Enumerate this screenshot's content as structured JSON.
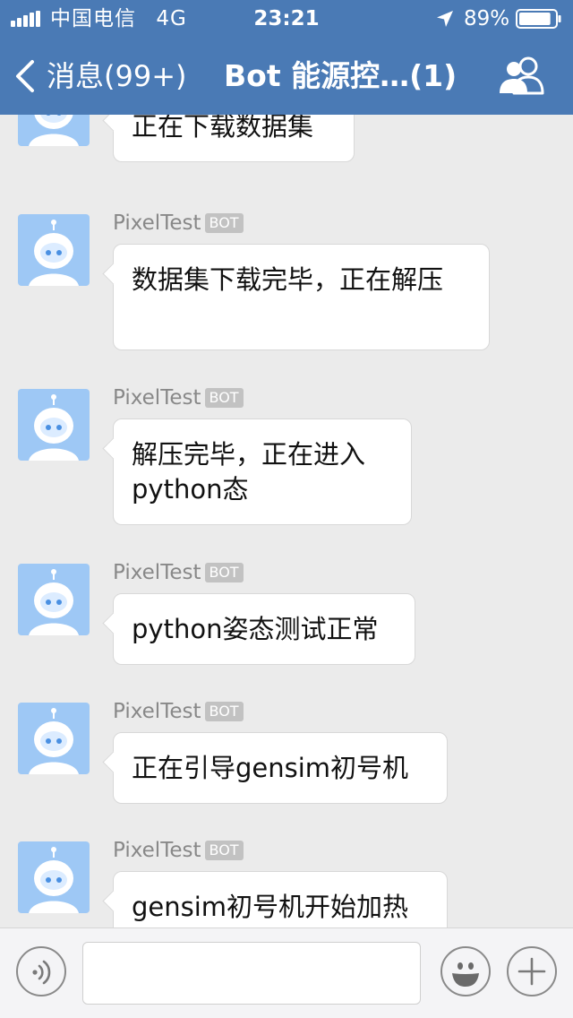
{
  "status_bar": {
    "carrier": "中国电信",
    "network": "4G",
    "time": "23:21",
    "battery": "89%",
    "battery_level": 0.89
  },
  "nav": {
    "back_label": "消息(99+)",
    "title": "Bot 能源控…(1)"
  },
  "chat": {
    "messages": [
      {
        "sender": "",
        "badge": "",
        "text": "正在下载数据集"
      },
      {
        "sender": "PixelTest",
        "badge": "BOT",
        "text": "数据集下载完毕，正在解压"
      },
      {
        "sender": "PixelTest",
        "badge": "BOT",
        "text": "解压完毕，正在进入python态"
      },
      {
        "sender": "PixelTest",
        "badge": "BOT",
        "text": "python姿态测试正常"
      },
      {
        "sender": "PixelTest",
        "badge": "BOT",
        "text": "正在引导gensim初号机"
      },
      {
        "sender": "PixelTest",
        "badge": "BOT",
        "text": "gensim初号机开始加热"
      }
    ]
  },
  "input_bar": {
    "text_value": "",
    "placeholder": ""
  },
  "colors": {
    "header": "#4a7ab5",
    "background": "#ebebeb",
    "bubble": "#ffffff",
    "avatar": "#9ec8f5",
    "badge": "#c2c2c2"
  },
  "icons": {
    "signal": "signal-bars-icon",
    "location": "location-arrow-icon",
    "battery": "battery-icon",
    "back": "chevron-left-icon",
    "group": "group-members-icon",
    "avatar": "robot-avatar-icon",
    "voice": "voice-icon",
    "emoji": "emoji-icon",
    "add": "plus-icon"
  }
}
